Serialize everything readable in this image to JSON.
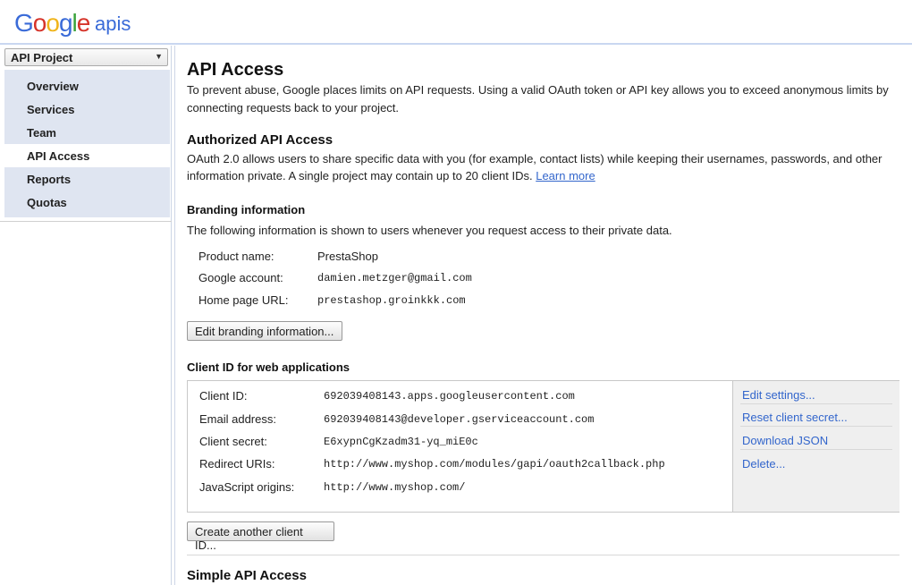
{
  "header": {
    "logo_letters": [
      "G",
      "o",
      "o",
      "g",
      "l",
      "e"
    ],
    "apis_label": "apis"
  },
  "sidebar": {
    "project_selector": "API Project",
    "items": [
      {
        "label": "Overview",
        "active": false
      },
      {
        "label": "Services",
        "active": false
      },
      {
        "label": "Team",
        "active": false
      },
      {
        "label": "API Access",
        "active": true
      },
      {
        "label": "Reports",
        "active": false
      },
      {
        "label": "Quotas",
        "active": false
      }
    ]
  },
  "main": {
    "title": "API Access",
    "intro_line1": "To prevent abuse, Google places limits on API requests. Using a valid OAuth token or API key allows you to exceed anonymous limits by",
    "intro_line2": "connecting requests back to your project.",
    "authorized": {
      "heading": "Authorized API Access",
      "line1": "OAuth 2.0 allows users to share specific data with you (for example, contact lists) while keeping their usernames, passwords, and other",
      "line2": "information private. A single project may contain up to 20 client IDs.",
      "learn_more": "Learn more"
    },
    "branding": {
      "heading": "Branding information",
      "description": "The following information is shown to users whenever you request access to their private data.",
      "rows": [
        {
          "label": "Product name:",
          "value": "PrestaShop"
        },
        {
          "label": "Google account:",
          "value": "damien.metzger@gmail.com"
        },
        {
          "label": "Home page URL:",
          "value": "prestashop.groinkkk.com"
        }
      ],
      "edit_button": "Edit branding information..."
    },
    "client": {
      "heading": "Client ID for web applications",
      "rows": [
        {
          "label": "Client ID:",
          "value": "692039408143.apps.googleusercontent.com"
        },
        {
          "label": "Email address:",
          "value": "692039408143@developer.gserviceaccount.com"
        },
        {
          "label": "Client secret:",
          "value": "E6xypnCgKzadm31-yq_miE0c"
        },
        {
          "label": "Redirect URIs:",
          "value": "http://www.myshop.com/modules/gapi/oauth2callback.php"
        },
        {
          "label": "JavaScript origins:",
          "value": "http://www.myshop.com/"
        }
      ],
      "actions": [
        "Edit settings...",
        "Reset client secret...",
        "Download JSON",
        "Delete..."
      ],
      "create_button": "Create another client ID..."
    },
    "simple": {
      "heading": "Simple API Access"
    }
  }
}
